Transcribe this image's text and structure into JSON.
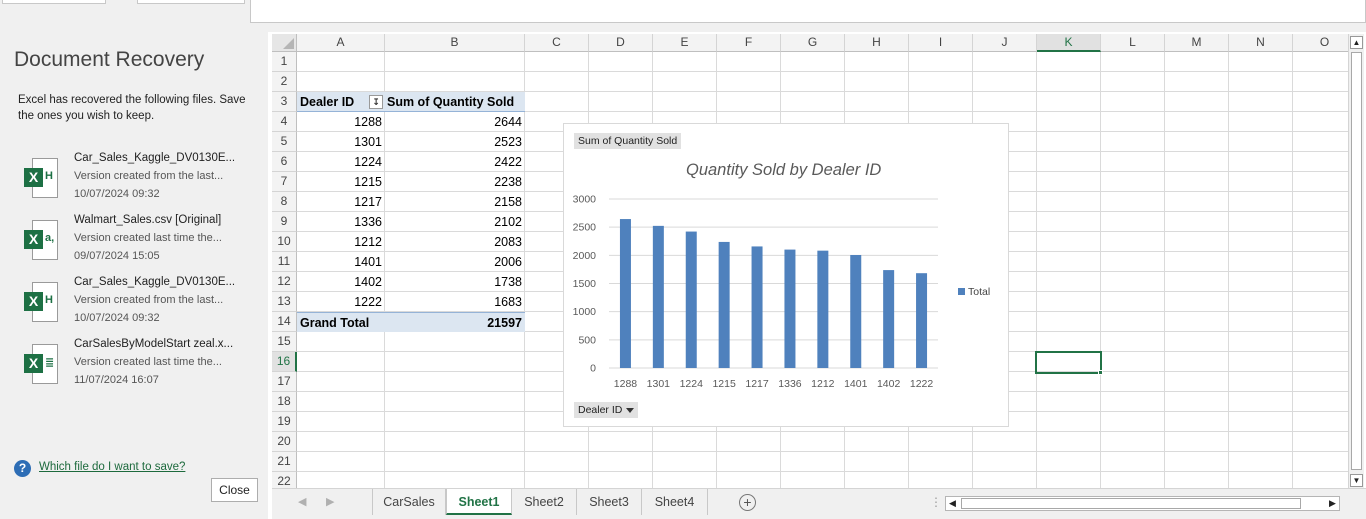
{
  "recovery": {
    "title": "Document Recovery",
    "description": "Excel has recovered the following files.  Save the ones you wish to keep.",
    "files": [
      {
        "name": "Car_Sales_Kaggle_DV0130E...",
        "desc": "Version created from the last...",
        "date": "10/07/2024 09:32",
        "icon": "excel-autosave-icon",
        "mark": "H"
      },
      {
        "name": "Walmart_Sales.csv  [Original]",
        "desc": "Version created last time the...",
        "date": "09/07/2024 15:05",
        "icon": "excel-csv-icon",
        "mark": "a,"
      },
      {
        "name": "Car_Sales_Kaggle_DV0130E...",
        "desc": "Version created from the last...",
        "date": "10/07/2024 09:32",
        "icon": "excel-autosave-icon",
        "mark": "H"
      },
      {
        "name": "CarSalesByModelStart zeal.x...",
        "desc": "Version created last time the...",
        "date": "11/07/2024 16:07",
        "icon": "excel-workbook-icon",
        "mark": "≣"
      }
    ],
    "help_link": "Which file do I want to save?",
    "close_label": "Close"
  },
  "grid": {
    "columns": [
      "A",
      "B",
      "C",
      "D",
      "E",
      "F",
      "G",
      "H",
      "I",
      "J",
      "K",
      "L",
      "M",
      "N",
      "O"
    ],
    "selected_column": "K",
    "rows": [
      "1",
      "2",
      "3",
      "4",
      "5",
      "6",
      "7",
      "8",
      "9",
      "10",
      "11",
      "12",
      "13",
      "14",
      "15",
      "16",
      "17",
      "18",
      "19",
      "20",
      "21",
      "22"
    ],
    "selected_row": "16",
    "pivot": {
      "header_a": "Dealer ID",
      "header_b": "Sum of Quantity Sold",
      "rows": [
        {
          "id": "1288",
          "qty": "2644"
        },
        {
          "id": "1301",
          "qty": "2523"
        },
        {
          "id": "1224",
          "qty": "2422"
        },
        {
          "id": "1215",
          "qty": "2238"
        },
        {
          "id": "1217",
          "qty": "2158"
        },
        {
          "id": "1336",
          "qty": "2102"
        },
        {
          "id": "1212",
          "qty": "2083"
        },
        {
          "id": "1401",
          "qty": "2006"
        },
        {
          "id": "1402",
          "qty": "1738"
        },
        {
          "id": "1222",
          "qty": "1683"
        }
      ],
      "total_label": "Grand Total",
      "total_value": "21597"
    }
  },
  "chart": {
    "field_button": "Sum of Quantity Sold",
    "axis_field_button": "Dealer ID",
    "legend_color": "#4f81bd"
  },
  "chart_data": {
    "type": "bar",
    "title": "Quantity Sold by Dealer ID",
    "categories": [
      "1288",
      "1301",
      "1224",
      "1215",
      "1217",
      "1336",
      "1212",
      "1401",
      "1402",
      "1222"
    ],
    "series": [
      {
        "name": "Total",
        "values": [
          2644,
          2523,
          2422,
          2238,
          2158,
          2102,
          2083,
          2006,
          1738,
          1683
        ]
      }
    ],
    "yticks": [
      "0",
      "500",
      "1000",
      "1500",
      "2000",
      "2500",
      "3000"
    ],
    "ylim": [
      0,
      3000
    ],
    "grid": true,
    "legend": "right"
  },
  "sheets": {
    "tabs": [
      "CarSales",
      "Sheet1",
      "Sheet2",
      "Sheet3",
      "Sheet4"
    ],
    "active": "Sheet1"
  }
}
